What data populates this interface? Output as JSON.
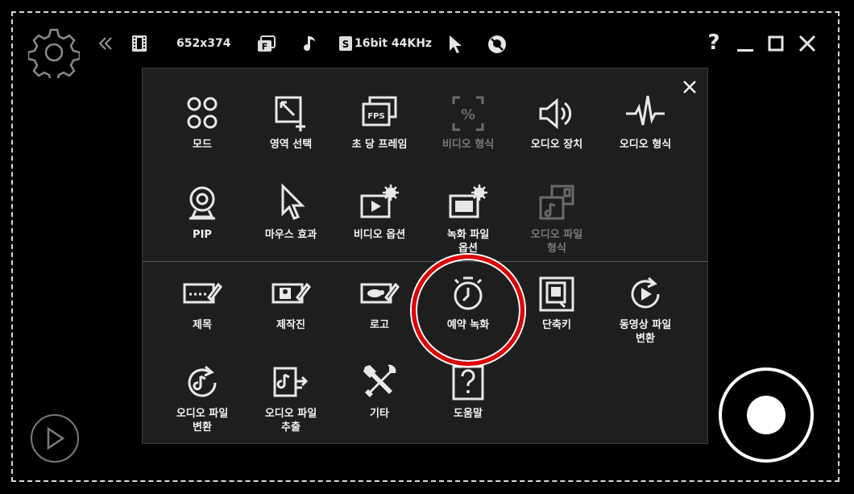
{
  "toolbar": {
    "resolution": "652x374",
    "audio_format": "16bit 44KHz",
    "fps_badge": "F",
    "audio_badge": "S",
    "help": "?"
  },
  "menu": {
    "items": [
      {
        "label": "모드",
        "icon": "mode-grid-icon",
        "enabled": true
      },
      {
        "label": "영역 선택",
        "icon": "area-select-icon",
        "enabled": true
      },
      {
        "label": "초 당 프레임",
        "icon": "fps-icon",
        "enabled": true
      },
      {
        "label": "비디오 형식",
        "icon": "video-format-icon",
        "enabled": false
      },
      {
        "label": "오디오 장치",
        "icon": "speaker-icon",
        "enabled": true
      },
      {
        "label": "오디오 형식",
        "icon": "waveform-icon",
        "enabled": true
      },
      {
        "label": "PIP",
        "icon": "webcam-icon",
        "enabled": true
      },
      {
        "label": "마우스 효과",
        "icon": "mouse-cursor-icon",
        "enabled": true
      },
      {
        "label": "비디오 옵션",
        "icon": "video-options-icon",
        "enabled": true
      },
      {
        "label": "녹화 파일\n옵션",
        "icon": "record-file-options-icon",
        "enabled": true
      },
      {
        "label": "오디오 파일\n형식",
        "icon": "audio-file-format-icon",
        "enabled": false
      },
      {
        "label": "제목",
        "icon": "title-icon",
        "enabled": true
      },
      {
        "label": "제작진",
        "icon": "credits-icon",
        "enabled": true
      },
      {
        "label": "로고",
        "icon": "logo-icon",
        "enabled": true
      },
      {
        "label": "예약 녹화",
        "icon": "clock-icon",
        "enabled": true
      },
      {
        "label": "단축키",
        "icon": "hotkey-icon",
        "enabled": true
      },
      {
        "label": "동영상 파일\n변환",
        "icon": "video-convert-icon",
        "enabled": true
      },
      {
        "label": "오디오 파일\n변환",
        "icon": "audio-convert-icon",
        "enabled": true
      },
      {
        "label": "오디오 파일\n추출",
        "icon": "audio-extract-icon",
        "enabled": true
      },
      {
        "label": "기타",
        "icon": "tools-icon",
        "enabled": true
      },
      {
        "label": "도움말",
        "icon": "help-icon",
        "enabled": true
      }
    ]
  },
  "colors": {
    "background": "#000000",
    "panel": "#1e1e1e",
    "highlight": "#e10000",
    "text": "#f2f2f2",
    "disabled": "#7a7a7a"
  }
}
